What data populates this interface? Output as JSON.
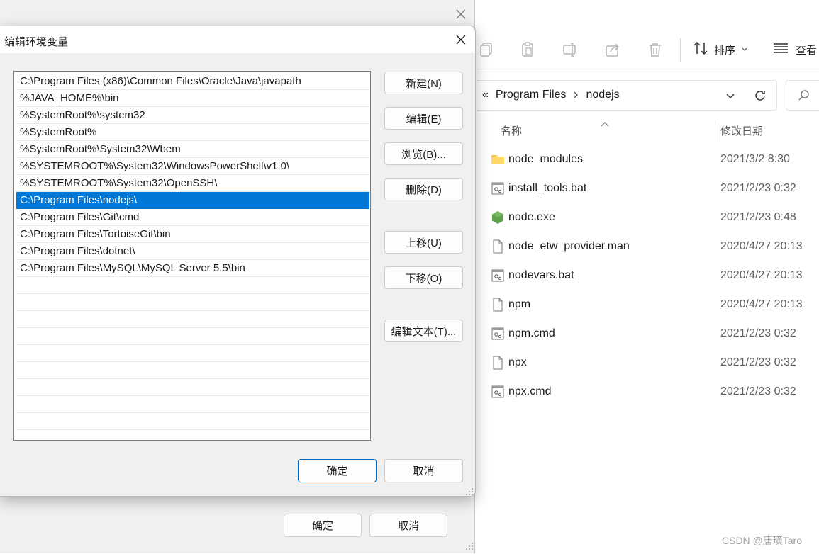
{
  "explorer": {
    "toolbar": {
      "sort_label": "排序",
      "view_label": "查看"
    },
    "breadcrumb": {
      "overflow": "«",
      "items": [
        "Program Files",
        "nodejs"
      ]
    },
    "columns": {
      "name": "名称",
      "date": "修改日期"
    },
    "files": [
      {
        "name": "node_modules",
        "date": "2021/3/2 8:30",
        "icon": "folder-icon"
      },
      {
        "name": "install_tools.bat",
        "date": "2021/2/23 0:32",
        "icon": "batch-file-icon"
      },
      {
        "name": "node.exe",
        "date": "2021/2/23 0:48",
        "icon": "nodejs-icon"
      },
      {
        "name": "node_etw_provider.man",
        "date": "2020/4/27 20:13",
        "icon": "file-icon"
      },
      {
        "name": "nodevars.bat",
        "date": "2020/4/27 20:13",
        "icon": "batch-file-icon"
      },
      {
        "name": "npm",
        "date": "2020/4/27 20:13",
        "icon": "file-icon"
      },
      {
        "name": "npm.cmd",
        "date": "2021/2/23 0:32",
        "icon": "batch-file-icon"
      },
      {
        "name": "npx",
        "date": "2021/2/23 0:32",
        "icon": "file-icon"
      },
      {
        "name": "npx.cmd",
        "date": "2021/2/23 0:32",
        "icon": "batch-file-icon"
      }
    ],
    "watermark": "CSDN @唐璜Taro"
  },
  "back_dialog": {
    "ok_label": "确定",
    "cancel_label": "取消"
  },
  "dialog": {
    "title": "编辑环境变量",
    "paths": [
      "C:\\Program Files (x86)\\Common Files\\Oracle\\Java\\javapath",
      "%JAVA_HOME%\\bin",
      "%SystemRoot%\\system32",
      "%SystemRoot%",
      "%SystemRoot%\\System32\\Wbem",
      "%SYSTEMROOT%\\System32\\WindowsPowerShell\\v1.0\\",
      "%SYSTEMROOT%\\System32\\OpenSSH\\",
      "C:\\Program Files\\nodejs\\",
      "C:\\Program Files\\Git\\cmd",
      "C:\\Program Files\\TortoiseGit\\bin",
      "C:\\Program Files\\dotnet\\",
      "C:\\Program Files\\MySQL\\MySQL Server 5.5\\bin"
    ],
    "selected_index": 7,
    "buttons": {
      "new": "新建(N)",
      "edit": "编辑(E)",
      "browse": "浏览(B)...",
      "delete": "删除(D)",
      "move_up": "上移(U)",
      "move_down": "下移(O)",
      "edit_text": "编辑文本(T)...",
      "ok": "确定",
      "cancel": "取消"
    }
  },
  "colors": {
    "selection": "#0078d7",
    "folder": "#f8c64a",
    "nodejs": "#5fa04e",
    "ok_border": "#0067c0"
  }
}
